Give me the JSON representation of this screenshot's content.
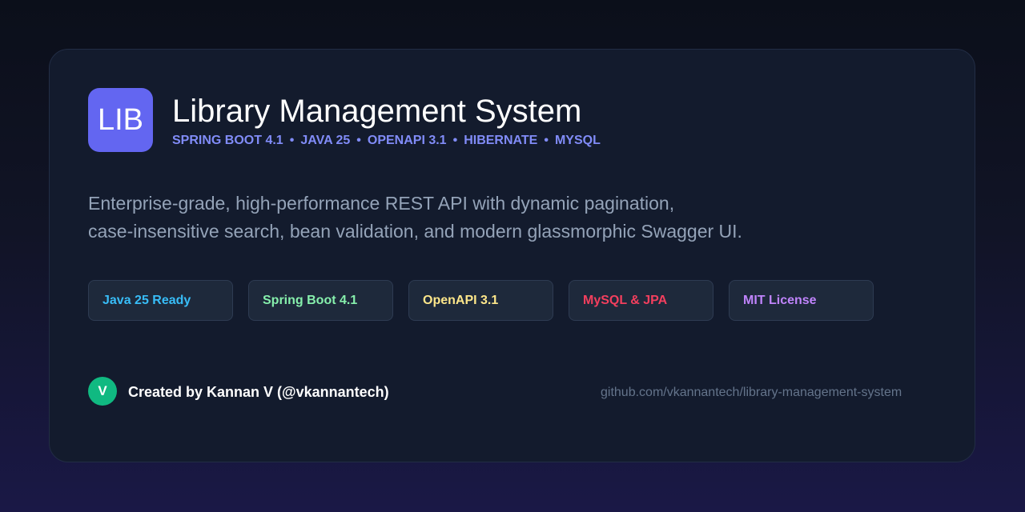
{
  "header": {
    "logo_text": "LIB",
    "title": "Library Management System",
    "stack": [
      "SPRING BOOT 4.1",
      "JAVA 25",
      "OPENAPI 3.1",
      "HIBERNATE",
      "MYSQL"
    ],
    "separator": "•"
  },
  "description": {
    "line1": "Enterprise-grade, high-performance REST API with dynamic pagination,",
    "line2": "case-insensitive search, bean validation, and modern glassmorphic Swagger UI."
  },
  "badges": [
    {
      "label": "Java 25 Ready",
      "color": "#38bdf8"
    },
    {
      "label": "Spring Boot 4.1",
      "color": "#86efac"
    },
    {
      "label": "OpenAPI 3.1",
      "color": "#fde68a"
    },
    {
      "label": "MySQL & JPA",
      "color": "#f43f5e"
    },
    {
      "label": "MIT License",
      "color": "#c084fc"
    }
  ],
  "footer": {
    "avatar_initial": "V",
    "creator": "Created by Kannan V (@vkannantech)",
    "repo": "github.com/vkannantech/library-management-system"
  },
  "colors": {
    "accent": "#6366f1",
    "stack_text": "#818cf8",
    "avatar": "#10b981"
  }
}
